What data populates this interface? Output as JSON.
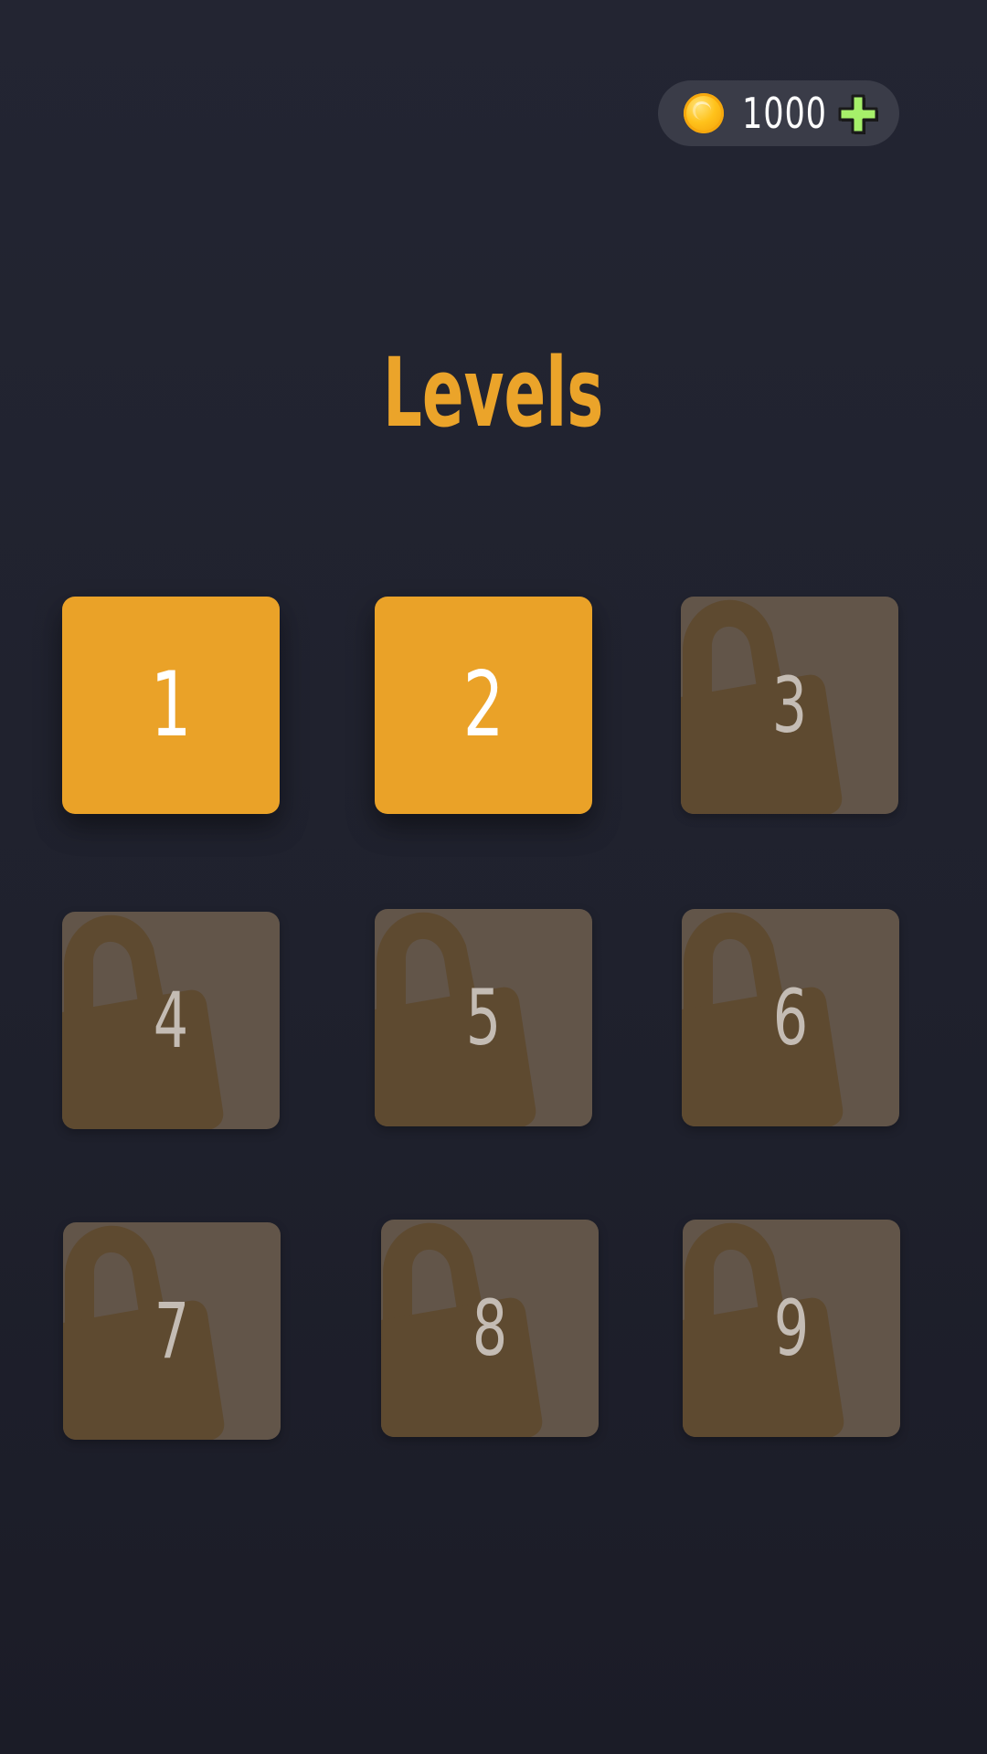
{
  "header": {
    "coins": "1000",
    "coin_icon": "gold-coin-icon",
    "plus_icon": "plus-icon",
    "plus_color": "#a6f06a"
  },
  "title": "Levels",
  "colors": {
    "accent": "#eba42a",
    "locked_tile": "#625549",
    "lock_shape": "#5e4a30",
    "background": "#22242f"
  },
  "levels": [
    {
      "number": "1",
      "status": "unlocked"
    },
    {
      "number": "2",
      "status": "unlocked"
    },
    {
      "number": "3",
      "status": "locked",
      "icon": "lock-icon"
    },
    {
      "number": "4",
      "status": "locked",
      "icon": "lock-icon"
    },
    {
      "number": "5",
      "status": "locked",
      "icon": "lock-icon"
    },
    {
      "number": "6",
      "status": "locked",
      "icon": "lock-icon"
    },
    {
      "number": "7",
      "status": "locked",
      "icon": "lock-icon"
    },
    {
      "number": "8",
      "status": "locked",
      "icon": "lock-icon"
    },
    {
      "number": "9",
      "status": "locked",
      "icon": "lock-icon"
    }
  ]
}
